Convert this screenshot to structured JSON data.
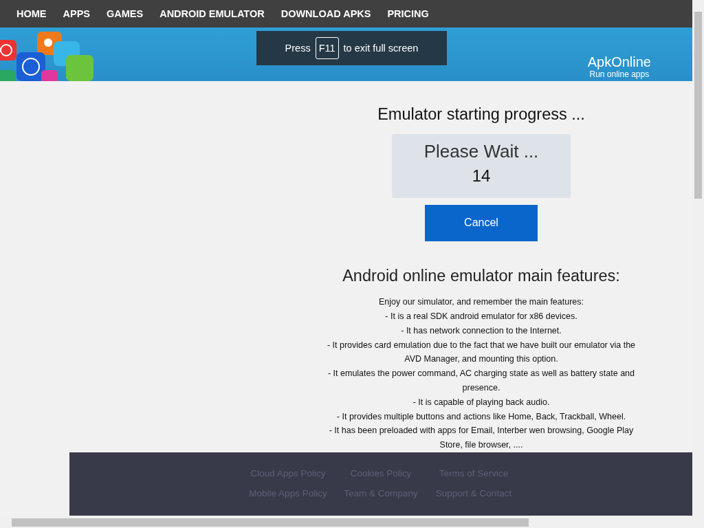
{
  "nav": [
    {
      "label": "HOME"
    },
    {
      "label": "APPS"
    },
    {
      "label": "GAMES"
    },
    {
      "label": "ANDROID EMULATOR"
    },
    {
      "label": "DOWNLOAD APKS"
    },
    {
      "label": "PRICING"
    }
  ],
  "banner": {
    "logo": {
      "name": "ApkOnline",
      "tagline": "Run online apps"
    }
  },
  "fullscreen_notice": {
    "before": "Press",
    "key": "F11",
    "after": "to exit full screen"
  },
  "progress": {
    "title": "Emulator starting progress ...",
    "status": "Please Wait ...",
    "counter": "14",
    "cancel": "Cancel"
  },
  "features": {
    "heading": "Android online emulator main features:",
    "lines": [
      "Enjoy our simulator, and remember the main features:",
      "- It is a real SDK android emulator for x86 devices.",
      "- It has network connection to the Internet.",
      "- It provides card emulation due to the fact that we have built our emulator via the AVD Manager, and mounting this option.",
      "- It emulates the power command, AC charging state as well as battery state and presence.",
      "- It is capable of playing back audio.",
      "- It provides multiple buttons and actions like Home, Back, Trackball, Wheel.",
      "- It has been preloaded with apps for Email, Interber wen browsing, Google Play Store, file browser, ...."
    ]
  },
  "footer": {
    "rows": [
      [
        "Cloud Apps Policy",
        "Cookies Policy",
        "Terms of Service"
      ],
      [
        "Mobile Apps Policy",
        "Team & Company",
        "Support & Contact"
      ]
    ]
  }
}
